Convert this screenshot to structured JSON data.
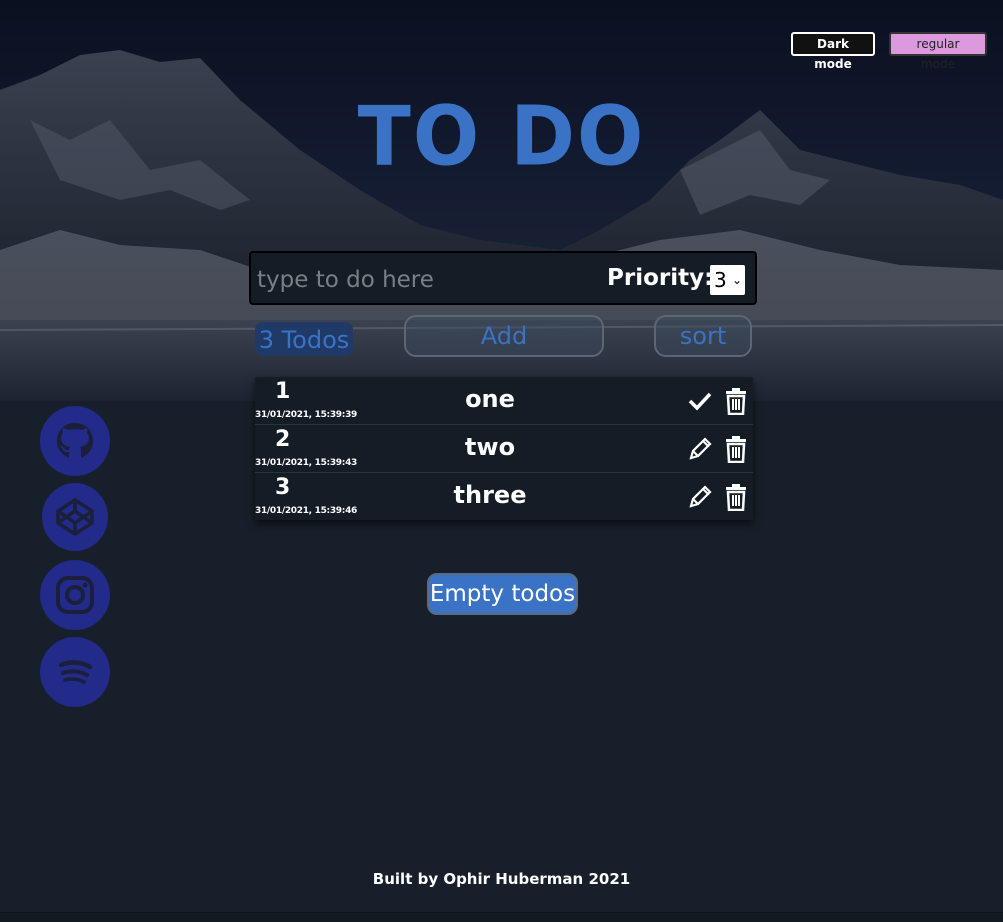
{
  "mode_buttons": {
    "dark": "Dark mode",
    "regular": "regular mode"
  },
  "title": "TO DO",
  "input": {
    "placeholder": "type to do here",
    "value": ""
  },
  "priority": {
    "label": "Priority:",
    "selected": "3"
  },
  "counter": "3 Todos",
  "add_label": "Add",
  "sort_label": "sort",
  "todos": [
    {
      "priority": "1",
      "date": "31/01/2021, 15:39:39",
      "text": "one",
      "action": "check-icon"
    },
    {
      "priority": "2",
      "date": "31/01/2021, 15:39:43",
      "text": "two",
      "action": "pencil-icon"
    },
    {
      "priority": "3",
      "date": "31/01/2021, 15:39:46",
      "text": "three",
      "action": "pencil-icon"
    }
  ],
  "social": [
    "github-icon",
    "codepen-icon",
    "instagram-icon",
    "spotify-icon"
  ],
  "empty_label": "Empty todos",
  "footer": "Built by Ophir Huberman 2021",
  "colors": {
    "accent": "#3a73c6",
    "background": "#17202a",
    "social": "#222a8a",
    "regular_mode": "#dd99dd"
  }
}
